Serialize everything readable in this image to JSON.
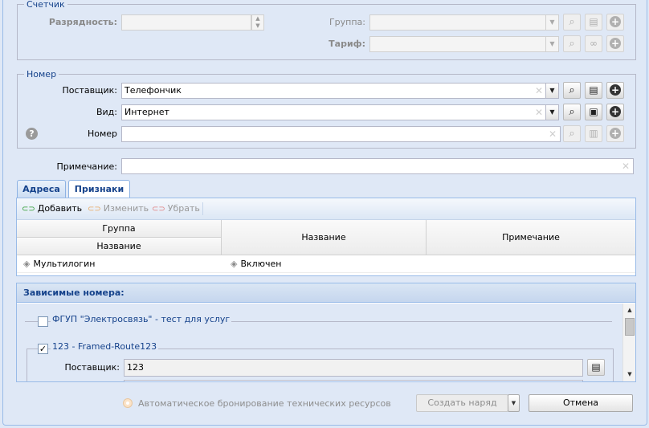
{
  "counter": {
    "legend": "Счетчик",
    "bitness_label": "Разрядность:",
    "group_label": "Группа:",
    "tariff_label": "Тариф:"
  },
  "number": {
    "legend": "Номер",
    "provider_label": "Поставщик:",
    "provider_value": "Телефончик",
    "type_label": "Вид:",
    "type_value": "Интернет",
    "number_label": "Номер",
    "number_value": ""
  },
  "note": {
    "label": "Примечание:",
    "value": ""
  },
  "tabs": [
    {
      "label": "Адреса",
      "active": false
    },
    {
      "label": "Признаки",
      "active": true
    }
  ],
  "toolbar": {
    "add_label": "Добавить",
    "edit_label": "Изменить",
    "remove_label": "Убрать"
  },
  "grid": {
    "header_group": "Группа",
    "header_group_name": "Название",
    "header_name": "Название",
    "header_note": "Примечание",
    "rows": [
      {
        "group_name": "Мультилогин",
        "name": "Включен",
        "note": ""
      }
    ]
  },
  "dependent": {
    "title": "Зависимые номера:",
    "groups": [
      {
        "title": "ФГУП \"Электросвязь\" - тест для услуг",
        "checked": false
      },
      {
        "title": "123 - Framed-Route123",
        "checked": true
      }
    ],
    "provider_label": "Поставщик:",
    "provider_value": "123"
  },
  "footer": {
    "auto_reserve_label": "Автоматическое бронирование технических ресурсов",
    "create_order_label": "Создать наряд",
    "cancel_label": "Отмена"
  },
  "colors": {
    "background": "#dfe8f6",
    "header_text": "#15428b",
    "border": "#99bbe8"
  },
  "icons": {
    "search": "magnifier-icon",
    "store": "store-icon",
    "link": "link-icon",
    "add": "plus-circle-icon",
    "help": "question-icon",
    "chain": "chain-link-icon",
    "tag": "tag-icon"
  }
}
